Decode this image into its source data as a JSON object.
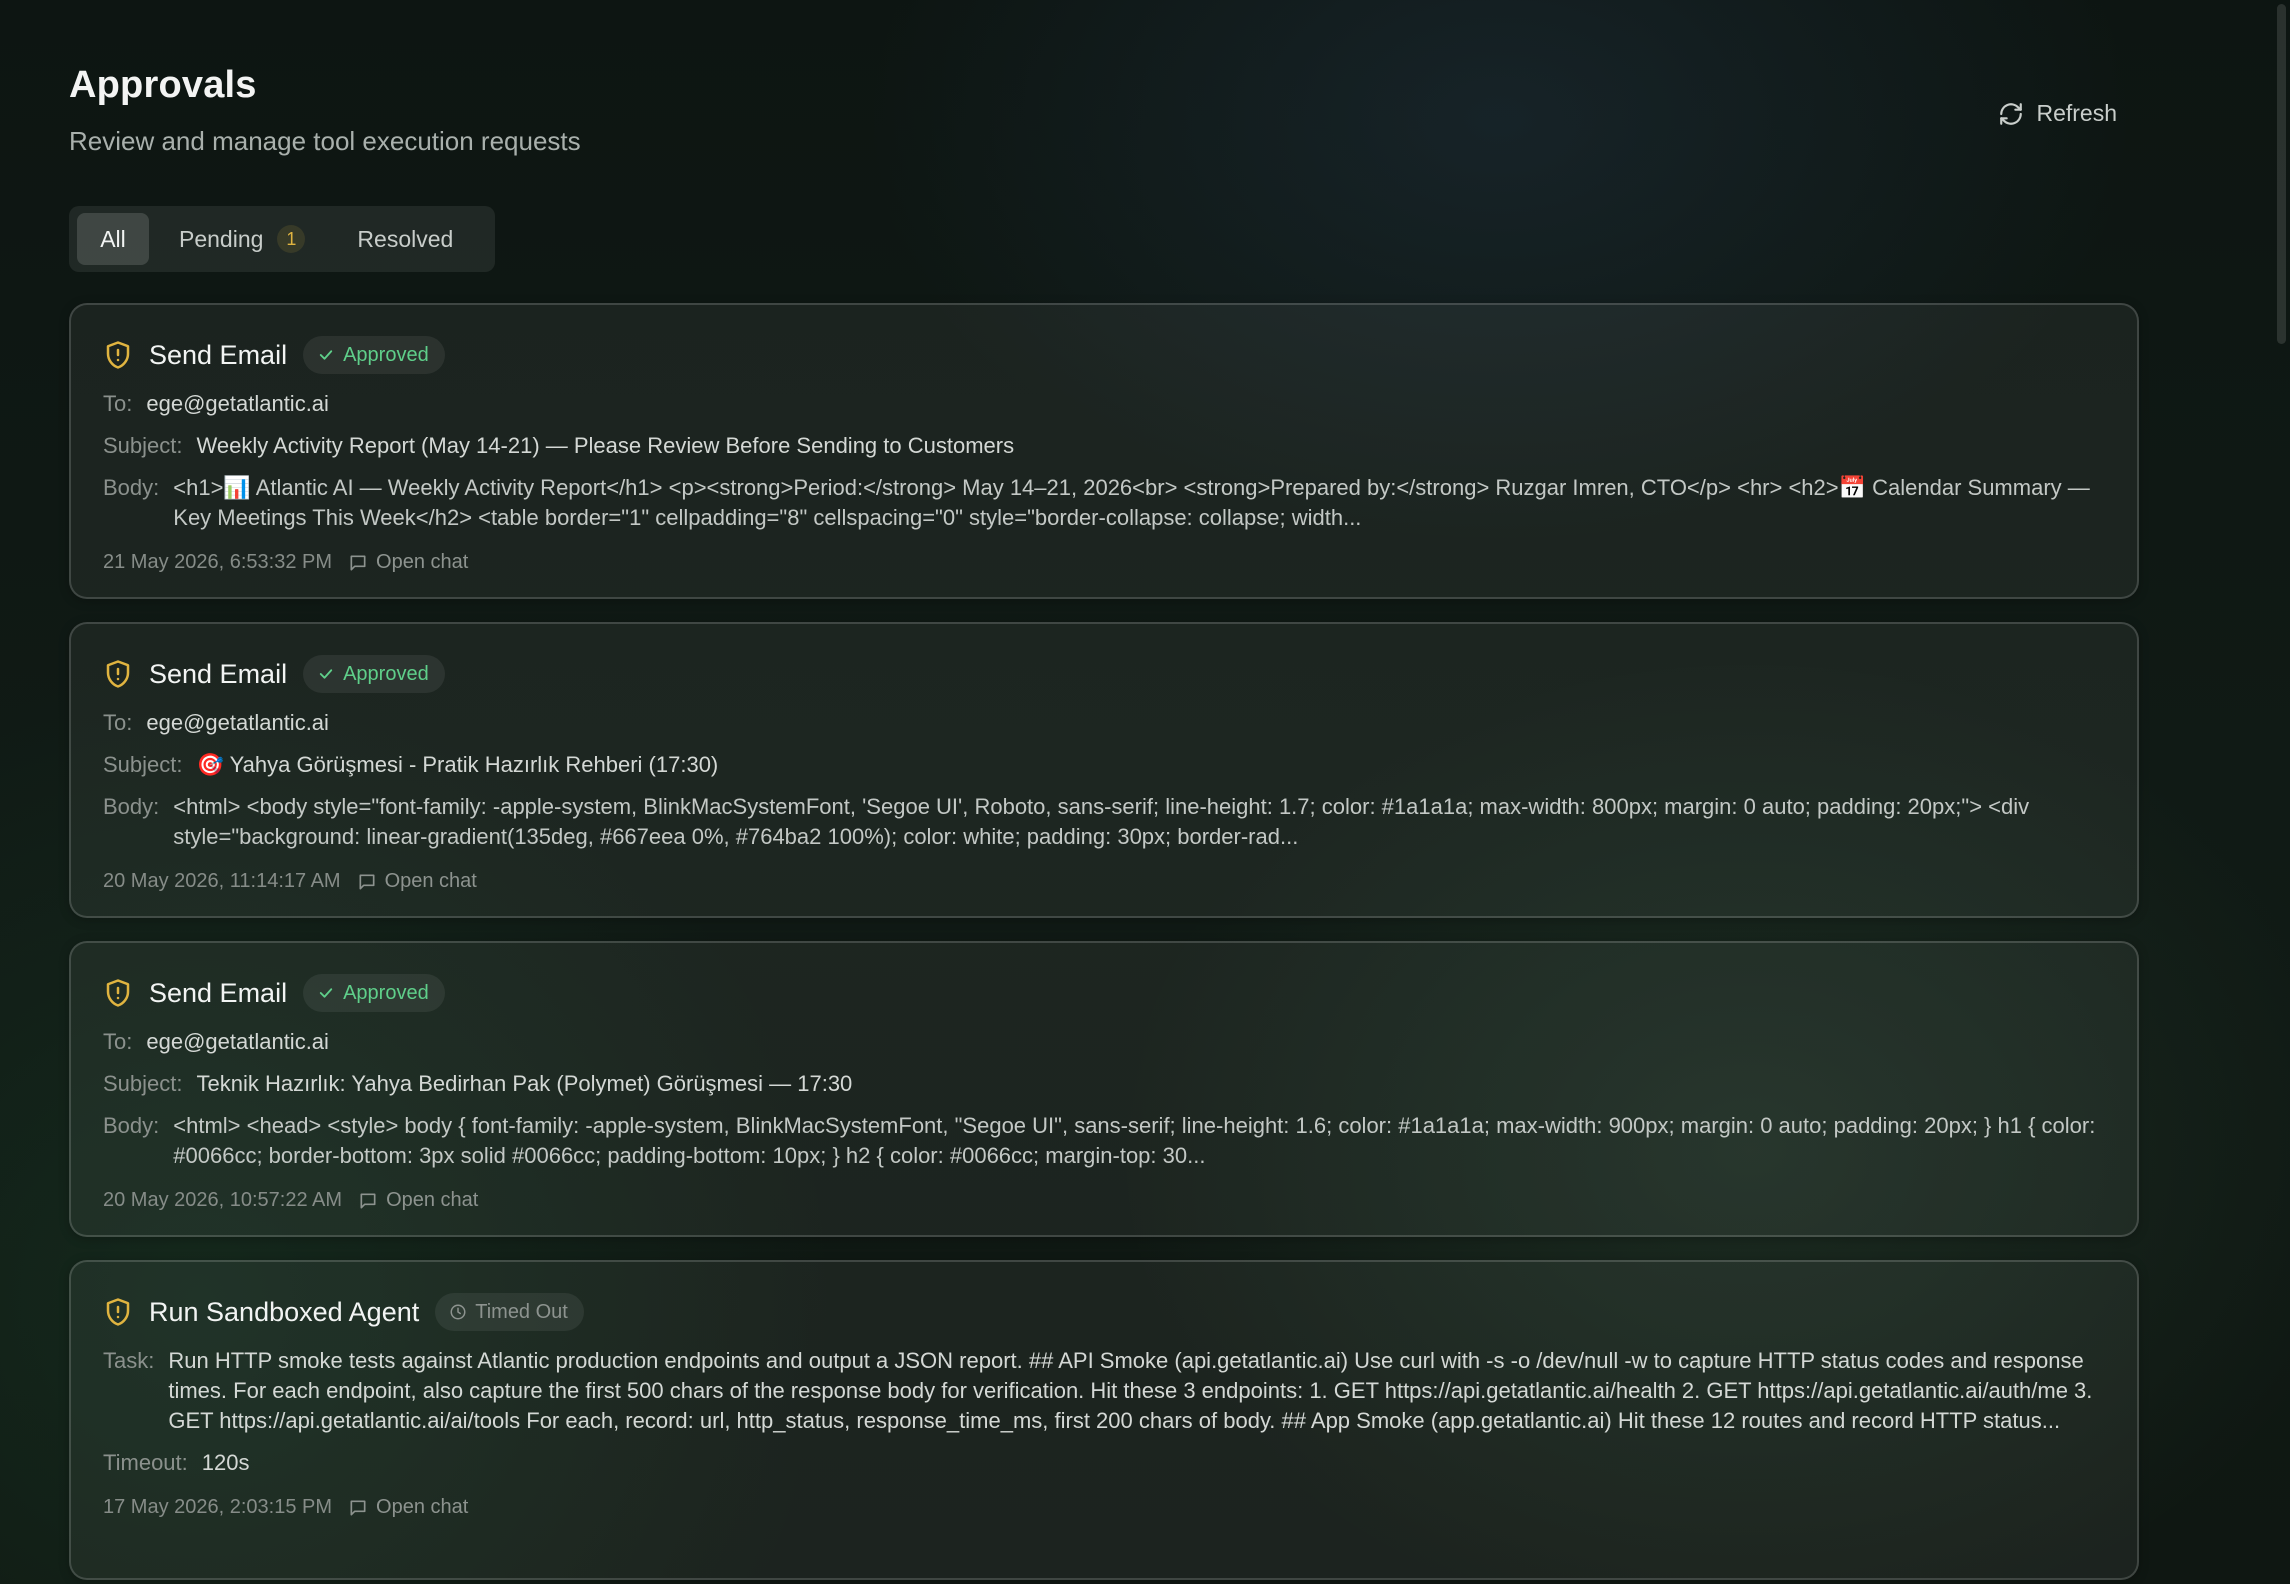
{
  "header": {
    "title": "Approvals",
    "subtitle": "Review and manage tool execution requests",
    "refresh_label": "Refresh"
  },
  "tabs": [
    {
      "label": "All",
      "active": true
    },
    {
      "label": "Pending",
      "badge": "1"
    },
    {
      "label": "Resolved"
    }
  ],
  "labels": {
    "to": "To:",
    "subject": "Subject:",
    "body": "Body:",
    "task": "Task:",
    "timeout": "Timeout:",
    "open_chat": "Open chat"
  },
  "cards": [
    {
      "title": "Send Email",
      "status": "Approved",
      "to": "ege@getatlantic.ai",
      "subject": "Weekly Activity Report (May 14-21) — Please Review Before Sending to Customers",
      "body": "<h1>📊 Atlantic AI — Weekly Activity Report</h1> <p><strong>Period:</strong> May 14–21, 2026<br> <strong>Prepared by:</strong> Ruzgar Imren, CTO</p> <hr> <h2>📅 Calendar Summary — Key Meetings This Week</h2> <table border=\"1\" cellpadding=\"8\" cellspacing=\"0\" style=\"border-collapse: collapse; width...",
      "timestamp": "21 May 2026, 6:53:32 PM"
    },
    {
      "title": "Send Email",
      "status": "Approved",
      "to": "ege@getatlantic.ai",
      "subject": "🎯 Yahya Görüşmesi - Pratik Hazırlık Rehberi (17:30)",
      "body": "<html> <body style=\"font-family: -apple-system, BlinkMacSystemFont, 'Segoe UI', Roboto, sans-serif; line-height: 1.7; color: #1a1a1a; max-width: 800px; margin: 0 auto; padding: 20px;\"> <div style=\"background: linear-gradient(135deg, #667eea 0%, #764ba2 100%); color: white; padding: 30px; border-rad...",
      "timestamp": "20 May 2026, 11:14:17 AM"
    },
    {
      "title": "Send Email",
      "status": "Approved",
      "to": "ege@getatlantic.ai",
      "subject": "Teknik Hazırlık: Yahya Bedirhan Pak (Polymet) Görüşmesi — 17:30",
      "body": "<html> <head> <style> body { font-family: -apple-system, BlinkMacSystemFont, \"Segoe UI\", sans-serif; line-height: 1.6; color: #1a1a1a; max-width: 900px; margin: 0 auto; padding: 20px; } h1 { color: #0066cc; border-bottom: 3px solid #0066cc; padding-bottom: 10px; } h2 { color: #0066cc; margin-top: 30...",
      "timestamp": "20 May 2026, 10:57:22 AM"
    },
    {
      "title": "Run Sandboxed Agent",
      "status": "Timed Out",
      "task": "Run HTTP smoke tests against Atlantic production endpoints and output a JSON report. ## API Smoke (api.getatlantic.ai) Use curl with -s -o /dev/null -w to capture HTTP status codes and response times. For each endpoint, also capture the first 500 chars of the response body for verification. Hit these 3 endpoints: 1. GET https://api.getatlantic.ai/health 2. GET https://api.getatlantic.ai/auth/me 3. GET https://api.getatlantic.ai/ai/tools For each, record: url, http_status, response_time_ms, first 200 chars of body. ## App Smoke (app.getatlantic.ai) Hit these 12 routes and record HTTP status...",
      "timeout": "120s",
      "timestamp": "17 May 2026, 2:03:15 PM"
    }
  ],
  "colors": {
    "approved": "#5fcf8a",
    "shield": "#e0b440",
    "timed_out": "#8d938f"
  }
}
